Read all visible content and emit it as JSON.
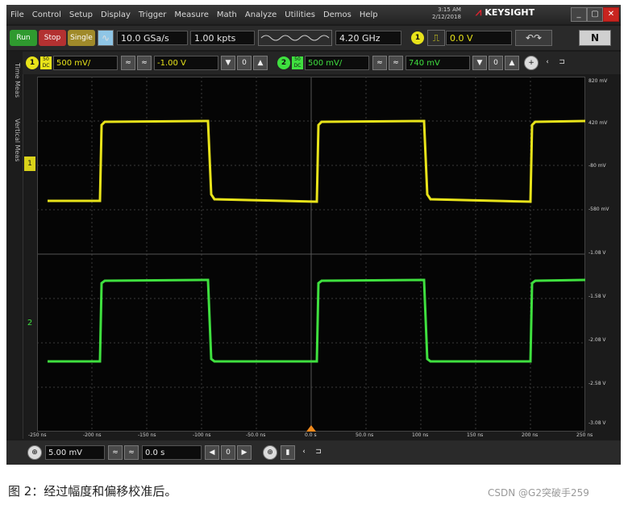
{
  "menu": [
    "File",
    "Control",
    "Setup",
    "Display",
    "Trigger",
    "Measure",
    "Math",
    "Analyze",
    "Utilities",
    "Demos",
    "Help"
  ],
  "clock": {
    "time": "3:15 AM",
    "date": "2/12/2018"
  },
  "brand": "KEYSIGHT",
  "window_buttons": [
    "_",
    "▢",
    "✕"
  ],
  "toolbar": {
    "run_label": "Run",
    "stop_label": "Stop",
    "single_label": "Single",
    "sample_rate": "10.0 GSa/s",
    "memory_depth": "1.00 kpts",
    "bandwidth": "4.20 GHz",
    "trigger_channel": "1",
    "trigger_level": "0.0 V"
  },
  "channels": [
    {
      "id": "1",
      "scale": "500 mV/",
      "offset": "-1.00 V",
      "color": "#e8e31a"
    },
    {
      "id": "2",
      "scale": "500 mV/",
      "offset": "740 mV",
      "color": "#3fe03f"
    }
  ],
  "side_tabs": [
    "Time Meas",
    "Vertical Meas"
  ],
  "right_scale": [
    "820 mV",
    "420 mV",
    "-80 mV",
    "-580 mV",
    "-1.08 V",
    "-1.58 V",
    "-2.08 V",
    "-2.58 V",
    "-3.08 V"
  ],
  "time_scale": [
    "-250 ns",
    "-200 ns",
    "-150 ns",
    "-100 ns",
    "-50.0 ns",
    "0.0 s",
    "50.0 ns",
    "100 ns",
    "150 ns",
    "200 ns",
    "250 ns"
  ],
  "bottom": {
    "timebase": "5.00 mV",
    "delay": "0.0 s"
  },
  "caption": "图 2：经过幅度和偏移校准后。",
  "watermark": "CSDN @G2突破手259"
}
